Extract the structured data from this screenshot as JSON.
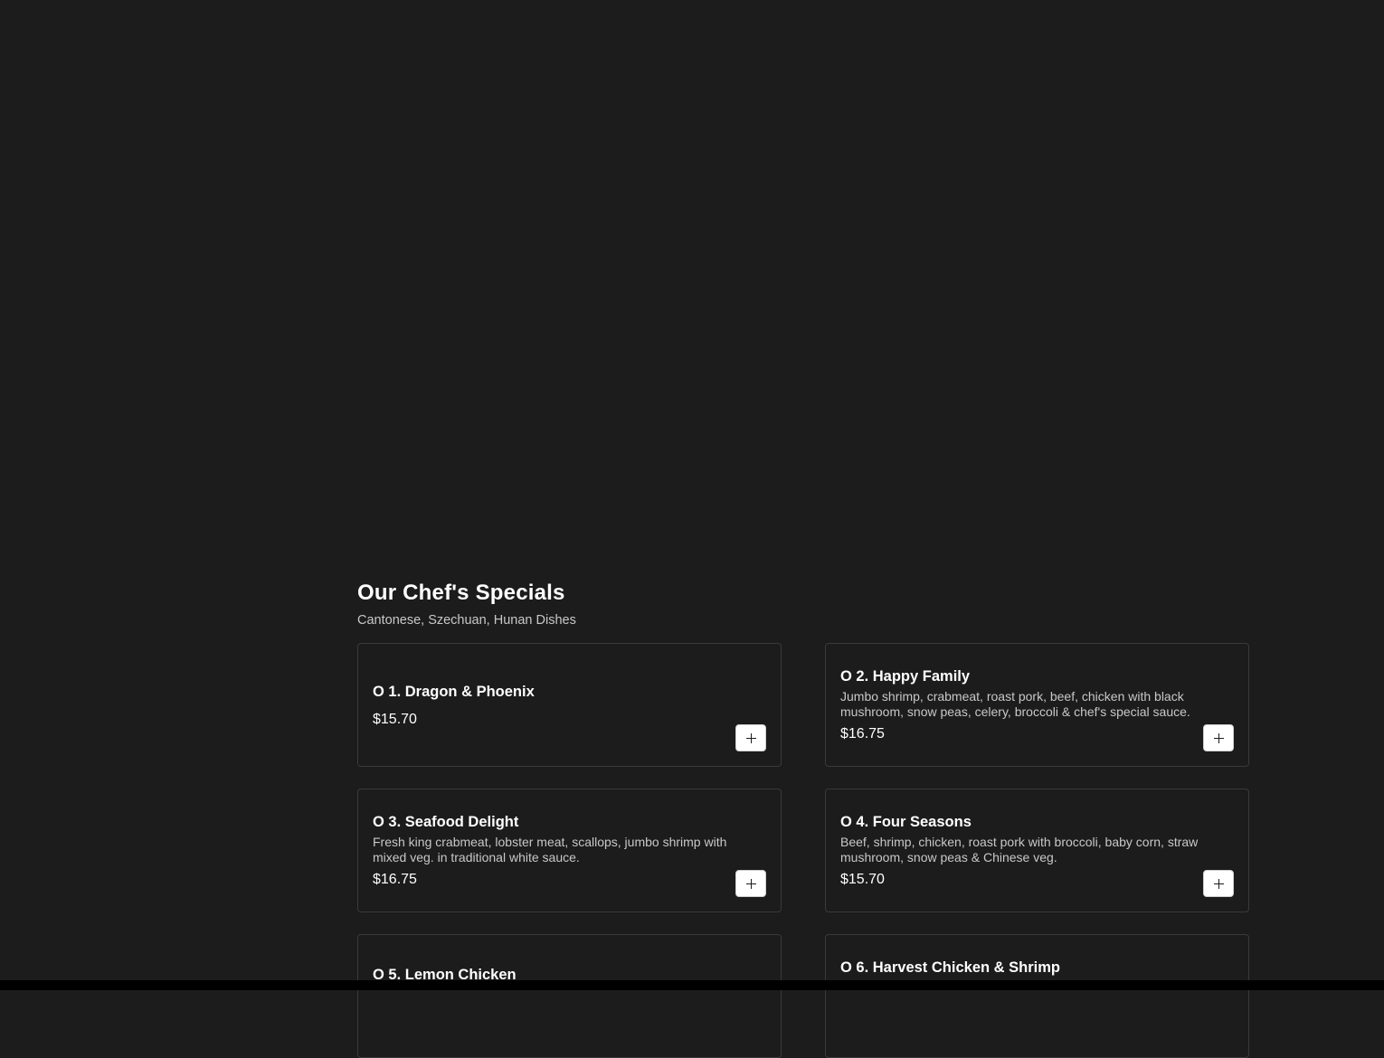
{
  "section": {
    "title": "Our Chef's Specials",
    "subtitle": "Cantonese, Szechuan, Hunan Dishes"
  },
  "items": [
    {
      "name": "O 1. Dragon & Phoenix",
      "description": "",
      "price": "$15.70"
    },
    {
      "name": "O 2. Happy Family",
      "description": "Jumbo shrimp, crabmeat, roast pork, beef, chicken with black mushroom, snow peas, celery, broccoli & chef's special sauce.",
      "price": "$16.75"
    },
    {
      "name": "O 3. Seafood Delight",
      "description": "Fresh king crabmeat, lobster meat, scallops, jumbo shrimp with mixed veg. in traditional white sauce.",
      "price": "$16.75"
    },
    {
      "name": "O 4. Four Seasons",
      "description": "Beef, shrimp, chicken, roast pork with broccoli, baby corn, straw mushroom, snow peas & Chinese veg.",
      "price": "$15.70"
    },
    {
      "name": "O 5. Lemon Chicken",
      "description": "",
      "price": ""
    },
    {
      "name": "O 6. Harvest Chicken & Shrimp",
      "description": "",
      "price": ""
    }
  ],
  "icons": {
    "add": "plus-icon"
  },
  "colors": {
    "background": "#1c1c1c",
    "card_border": "#3a3a3a",
    "button": "#ffffff"
  }
}
